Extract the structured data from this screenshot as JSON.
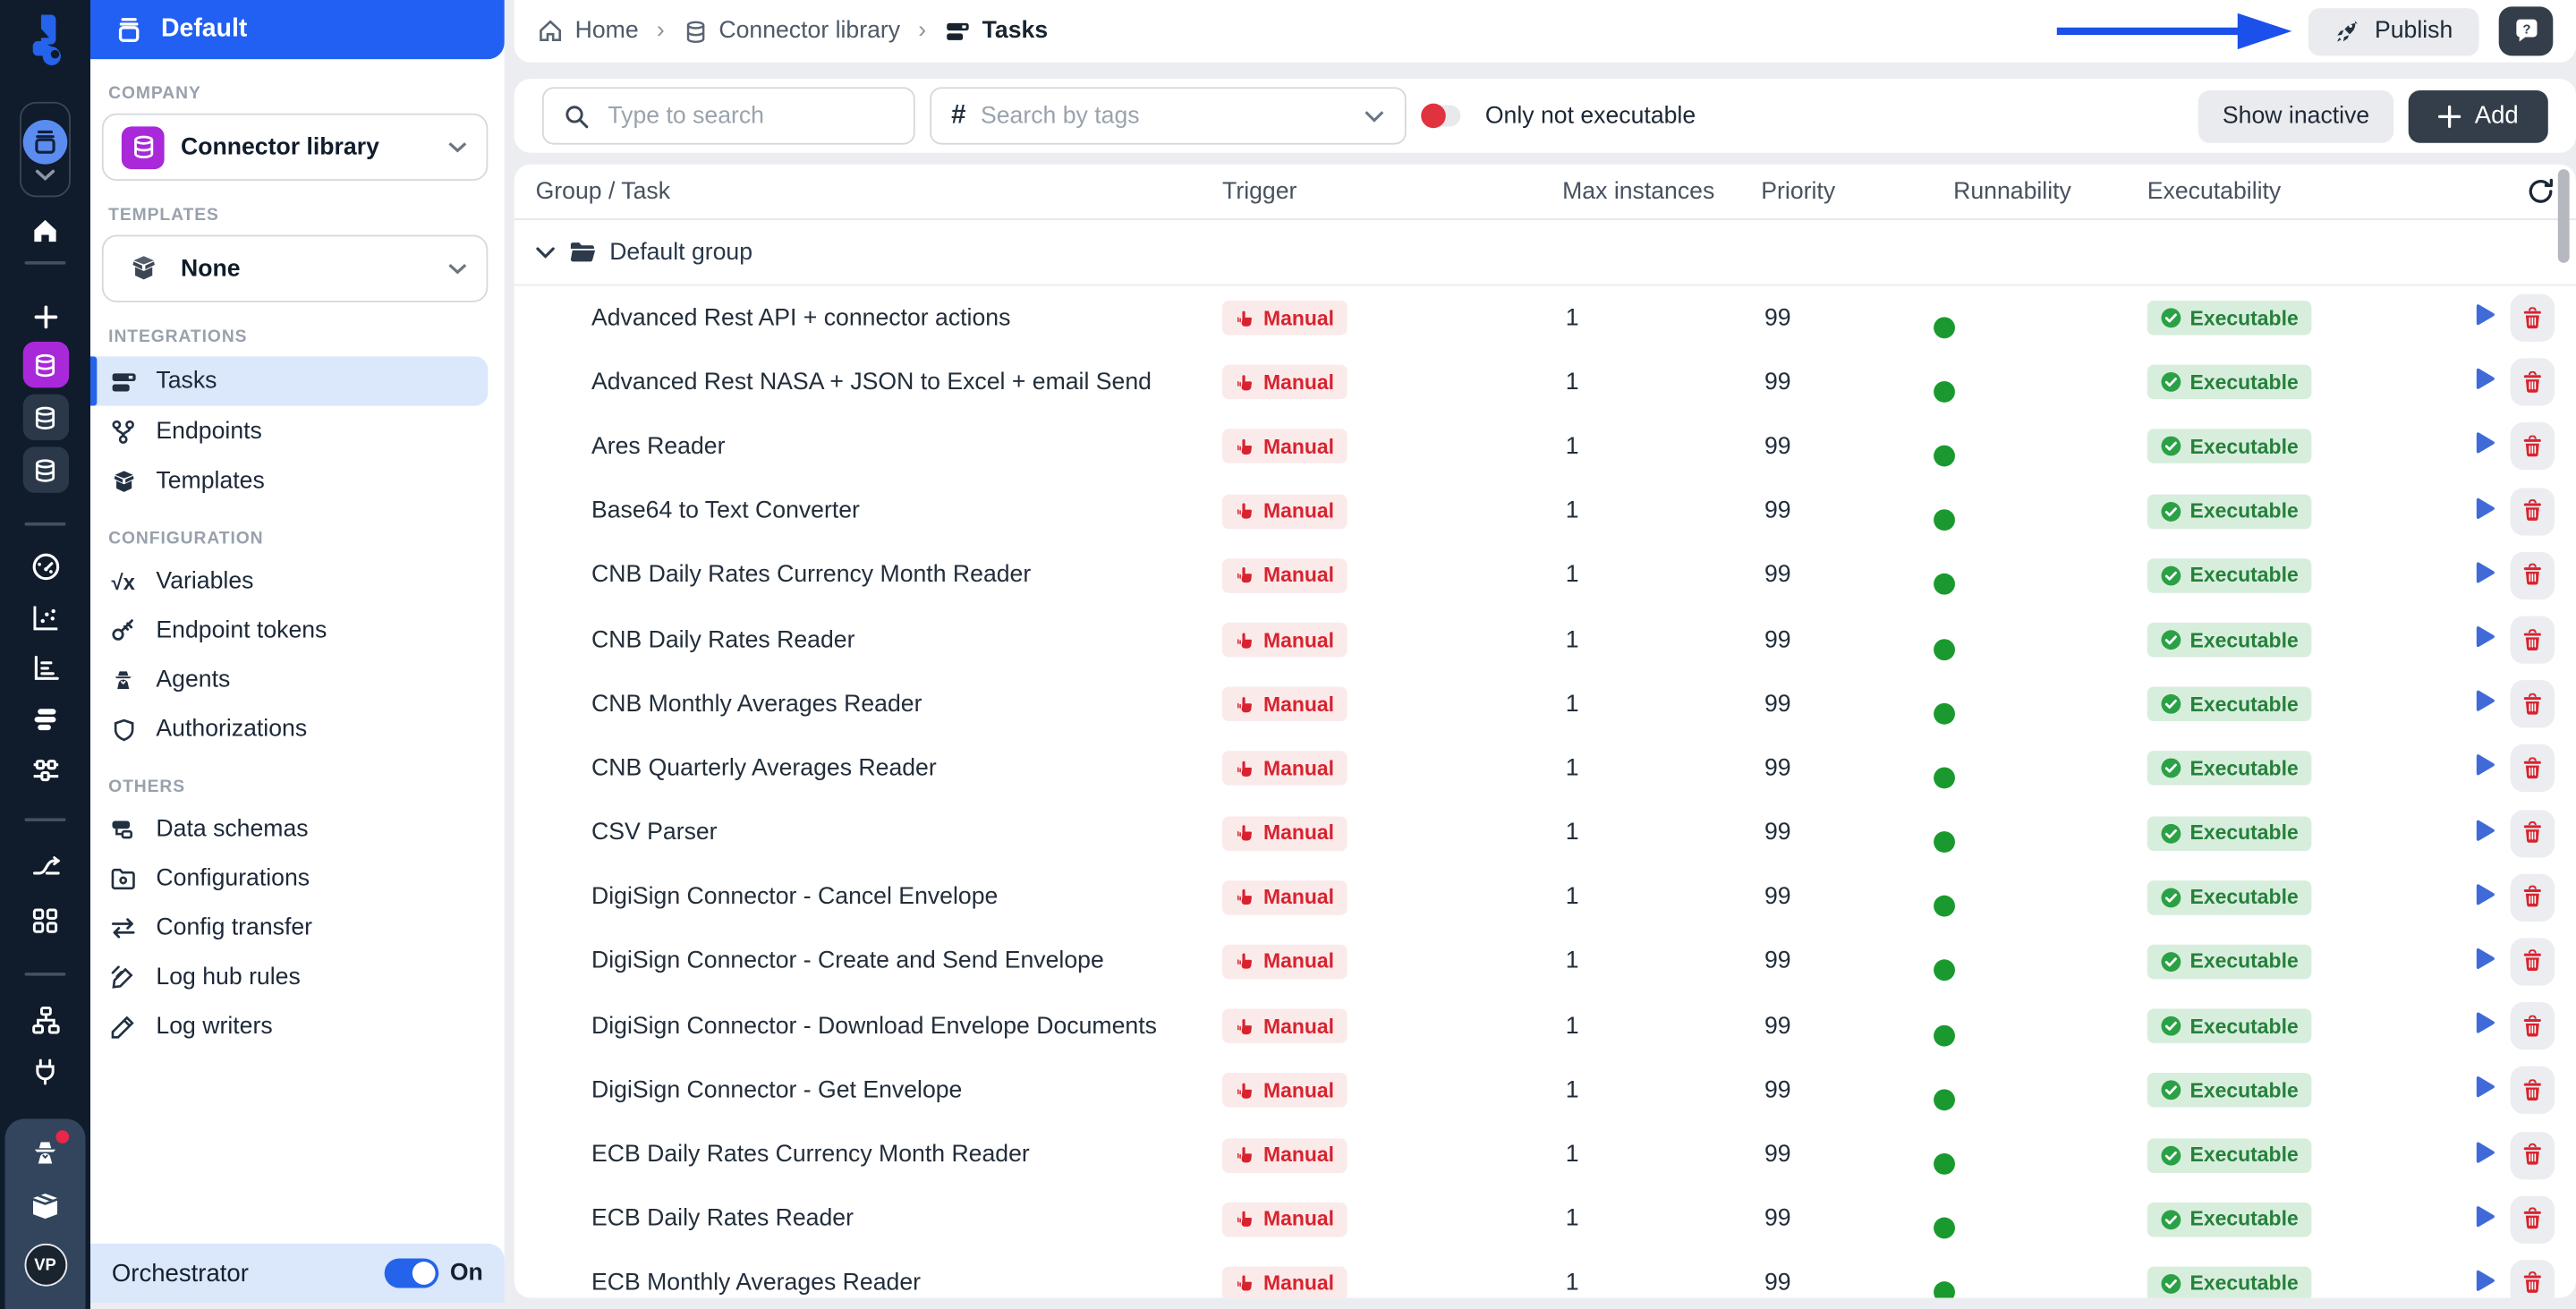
{
  "rail": {
    "avatar_initials": "VP",
    "orchestrator_logo": "frends-logo"
  },
  "sidebar": {
    "workspace_title": "Default",
    "company": {
      "label": "COMPANY",
      "value": "Connector library"
    },
    "templates": {
      "label": "TEMPLATES",
      "value": "None"
    },
    "nav": [
      {
        "label": "INTEGRATIONS",
        "items": [
          {
            "label": "Tasks"
          },
          {
            "label": "Endpoints"
          },
          {
            "label": "Templates"
          }
        ]
      },
      {
        "label": "CONFIGURATION",
        "items": [
          {
            "label": "Variables"
          },
          {
            "label": "Endpoint tokens"
          },
          {
            "label": "Agents"
          },
          {
            "label": "Authorizations"
          }
        ]
      },
      {
        "label": "OTHERS",
        "items": [
          {
            "label": "Data schemas"
          },
          {
            "label": "Configurations"
          },
          {
            "label": "Config transfer"
          },
          {
            "label": "Log hub rules"
          },
          {
            "label": "Log writers"
          }
        ]
      }
    ],
    "orchestrator": {
      "label": "Orchestrator",
      "state": "On"
    }
  },
  "topbar": {
    "breadcrumbs": [
      {
        "label": "Home"
      },
      {
        "label": "Connector library"
      },
      {
        "label": "Tasks"
      }
    ],
    "publish_label": "Publish"
  },
  "filters": {
    "search_placeholder": "Type to search",
    "tags_placeholder": "Search by tags",
    "only_not_executable_label": "Only not executable",
    "show_inactive_label": "Show inactive",
    "add_label": "Add"
  },
  "table": {
    "columns": [
      "Group / Task",
      "Trigger",
      "Max instances",
      "Priority",
      "Runnability",
      "Executability"
    ],
    "group_name": "Default group",
    "rows": [
      {
        "name": "Advanced Rest API + connector actions",
        "trigger": "Manual",
        "max_instances": "1",
        "priority": "99",
        "runnable": true,
        "executability": "Executable"
      },
      {
        "name": "Advanced Rest NASA + JSON to Excel + email Send",
        "trigger": "Manual",
        "max_instances": "1",
        "priority": "99",
        "runnable": true,
        "executability": "Executable"
      },
      {
        "name": "Ares Reader",
        "trigger": "Manual",
        "max_instances": "1",
        "priority": "99",
        "runnable": true,
        "executability": "Executable"
      },
      {
        "name": "Base64 to Text Converter",
        "trigger": "Manual",
        "max_instances": "1",
        "priority": "99",
        "runnable": true,
        "executability": "Executable"
      },
      {
        "name": "CNB Daily Rates Currency Month Reader",
        "trigger": "Manual",
        "max_instances": "1",
        "priority": "99",
        "runnable": true,
        "executability": "Executable"
      },
      {
        "name": "CNB Daily Rates Reader",
        "trigger": "Manual",
        "max_instances": "1",
        "priority": "99",
        "runnable": true,
        "executability": "Executable"
      },
      {
        "name": "CNB Monthly Averages Reader",
        "trigger": "Manual",
        "max_instances": "1",
        "priority": "99",
        "runnable": true,
        "executability": "Executable"
      },
      {
        "name": "CNB Quarterly Averages Reader",
        "trigger": "Manual",
        "max_instances": "1",
        "priority": "99",
        "runnable": true,
        "executability": "Executable"
      },
      {
        "name": "CSV Parser",
        "trigger": "Manual",
        "max_instances": "1",
        "priority": "99",
        "runnable": true,
        "executability": "Executable"
      },
      {
        "name": "DigiSign Connector - Cancel Envelope",
        "trigger": "Manual",
        "max_instances": "1",
        "priority": "99",
        "runnable": true,
        "executability": "Executable"
      },
      {
        "name": "DigiSign Connector - Create and Send Envelope",
        "trigger": "Manual",
        "max_instances": "1",
        "priority": "99",
        "runnable": true,
        "executability": "Executable"
      },
      {
        "name": "DigiSign Connector - Download Envelope Documents",
        "trigger": "Manual",
        "max_instances": "1",
        "priority": "99",
        "runnable": true,
        "executability": "Executable"
      },
      {
        "name": "DigiSign Connector - Get Envelope",
        "trigger": "Manual",
        "max_instances": "1",
        "priority": "99",
        "runnable": true,
        "executability": "Executable"
      },
      {
        "name": "ECB Daily Rates Currency Month Reader",
        "trigger": "Manual",
        "max_instances": "1",
        "priority": "99",
        "runnable": true,
        "executability": "Executable"
      },
      {
        "name": "ECB Daily Rates Reader",
        "trigger": "Manual",
        "max_instances": "1",
        "priority": "99",
        "runnable": true,
        "executability": "Executable"
      },
      {
        "name": "ECB Monthly Averages Reader",
        "trigger": "Manual",
        "max_instances": "1",
        "priority": "99",
        "runnable": true,
        "executability": "Executable"
      }
    ]
  },
  "colors": {
    "accent_blue": "#2160f3",
    "purple": "#a928d9",
    "manual_red": "#d8232f",
    "exec_green": "#26803b",
    "runnable_green": "#1a9a2e",
    "chat_lime": "#c2d22f",
    "annotation_arrow_blue": "#1b51ea",
    "rail_dark": "#101b2b"
  }
}
